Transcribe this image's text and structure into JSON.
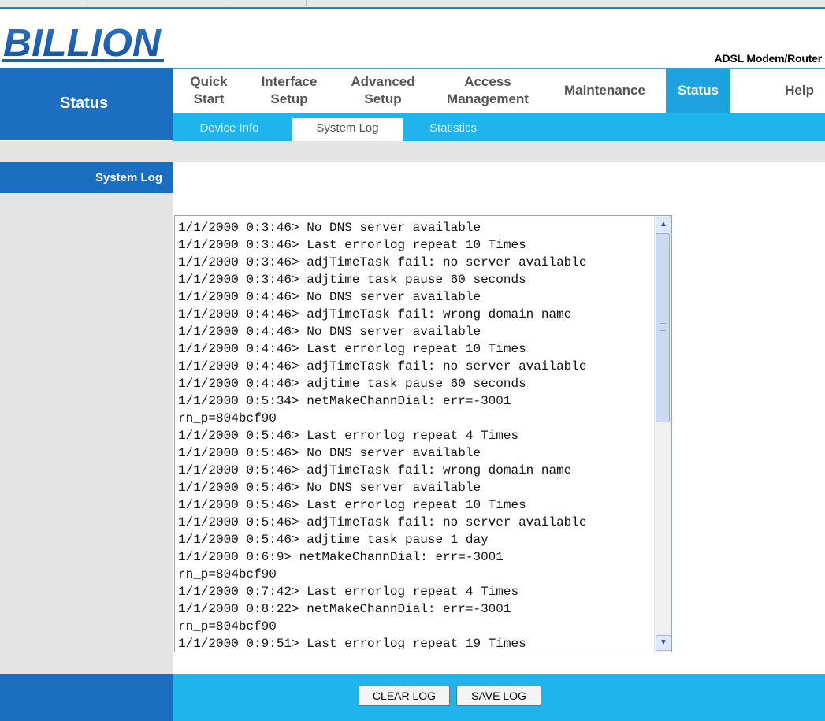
{
  "header": {
    "logo_text": "BILLION",
    "product_label": "ADSL Modem/Router"
  },
  "section_title": "Status",
  "main_nav": [
    {
      "label": "Quick\nStart"
    },
    {
      "label": "Interface\nSetup"
    },
    {
      "label": "Advanced\nSetup"
    },
    {
      "label": "Access\nManagement"
    },
    {
      "label": "Maintenance"
    },
    {
      "label": "Status",
      "active": true
    },
    {
      "label": "Help"
    }
  ],
  "sub_nav": [
    {
      "label": "Device Info"
    },
    {
      "label": "System Log",
      "active": true
    },
    {
      "label": "Statistics"
    }
  ],
  "page_label": "System Log",
  "log_lines": [
    "1/1/2000 0:3:46> No DNS server available",
    "1/1/2000 0:3:46> Last errorlog repeat 10 Times",
    "1/1/2000 0:3:46> adjTimeTask fail: no server available",
    "1/1/2000 0:3:46> adjtime task pause 60 seconds",
    "1/1/2000 0:4:46> No DNS server available",
    "1/1/2000 0:4:46> adjTimeTask fail: wrong domain name",
    "1/1/2000 0:4:46> No DNS server available",
    "1/1/2000 0:4:46> Last errorlog repeat 10 Times",
    "1/1/2000 0:4:46> adjTimeTask fail: no server available",
    "1/1/2000 0:4:46> adjtime task pause 60 seconds",
    "1/1/2000 0:5:34> netMakeChannDial: err=-3001",
    "rn_p=804bcf90",
    "1/1/2000 0:5:46> Last errorlog repeat 4 Times",
    "1/1/2000 0:5:46> No DNS server available",
    "1/1/2000 0:5:46> adjTimeTask fail: wrong domain name",
    "1/1/2000 0:5:46> No DNS server available",
    "1/1/2000 0:5:46> Last errorlog repeat 10 Times",
    "1/1/2000 0:5:46> adjTimeTask fail: no server available",
    "1/1/2000 0:5:46> adjtime task pause 1 day",
    "1/1/2000 0:6:9> netMakeChannDial: err=-3001",
    "rn_p=804bcf90",
    "1/1/2000 0:7:42> Last errorlog repeat 4 Times",
    "1/1/2000 0:8:22> netMakeChannDial: err=-3001",
    "rn_p=804bcf90",
    "1/1/2000 0:9:51> Last errorlog repeat 19 Times"
  ],
  "buttons": {
    "clear_label": "CLEAR LOG",
    "save_label": "SAVE LOG"
  },
  "colors": {
    "brand_blue": "#1c6fc0",
    "nav_cyan": "#1fb4ec",
    "active_tab": "#1da2de",
    "logo_blue": "#1f5fae"
  },
  "icons": {
    "scroll_up": "scroll-up-arrow-icon",
    "scroll_down": "scroll-down-arrow-icon"
  }
}
